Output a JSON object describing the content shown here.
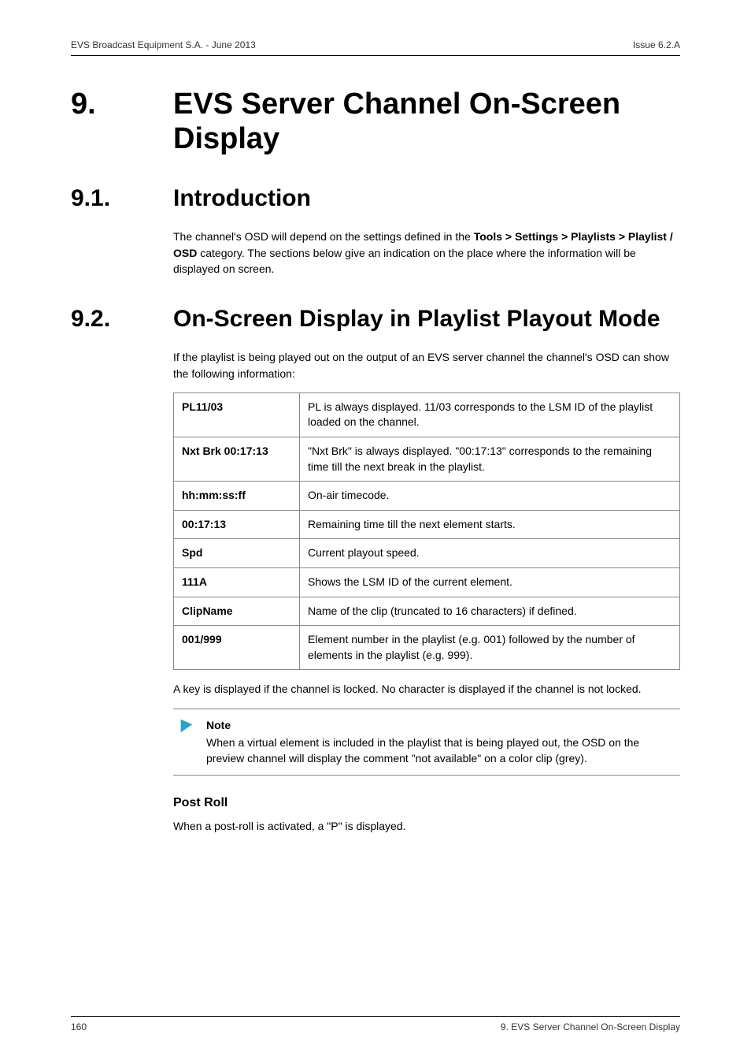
{
  "header": {
    "left": "EVS Broadcast Equipment S.A.  - June 2013",
    "right": "Issue 6.2.A"
  },
  "chapter": {
    "num": "9.",
    "title": "EVS Server Channel On-Screen Display"
  },
  "section_intro": {
    "num": "9.1.",
    "title": "Introduction",
    "para_parts": {
      "t1": "The channel's OSD will depend on the settings defined in the ",
      "b1": "Tools > Settings > Playlists > Playlist / OSD",
      "t2": " category. The sections below give an indication on the place where the information will be displayed on screen."
    }
  },
  "section_mode": {
    "num": "9.2.",
    "title": "On-Screen Display in Playlist Playout Mode",
    "lead": "If the playlist is being played out on the output of an EVS server channel the channel's OSD can show the following information:",
    "rows": [
      {
        "k": "PL11/03",
        "v": "PL is always displayed. 11/03 corresponds to the LSM ID of the playlist loaded on the channel."
      },
      {
        "k": "Nxt Brk 00:17:13",
        "v": "\"Nxt Brk\" is always displayed. \"00:17:13\" corresponds to the remaining time till the next break in the playlist."
      },
      {
        "k": "hh:mm:ss:ff",
        "v": "On-air timecode."
      },
      {
        "k": "00:17:13",
        "v": "Remaining time till the next element starts."
      },
      {
        "k": "Spd",
        "v": "Current playout speed."
      },
      {
        "k": "111A",
        "v": "Shows the LSM ID of the current element."
      },
      {
        "k": "ClipName",
        "v": "Name of the clip (truncated to 16 characters) if defined."
      },
      {
        "k": "001/999",
        "v": "Element number in the playlist (e.g. 001)  followed by the number of elements in the playlist (e.g. 999)."
      }
    ],
    "after_table": "A key is displayed if the channel is locked. No character is displayed if the channel is not locked.",
    "note": {
      "label": "Note",
      "body": "When a virtual element is included in the playlist that is being played out, the OSD on the preview channel will display the comment \"not available\" on a color clip (grey)."
    },
    "postroll": {
      "heading": "Post Roll",
      "body": "When a post-roll is activated, a \"P\" is displayed."
    }
  },
  "footer": {
    "page": "160",
    "section_label": "9. EVS Server Channel On-Screen Display"
  }
}
